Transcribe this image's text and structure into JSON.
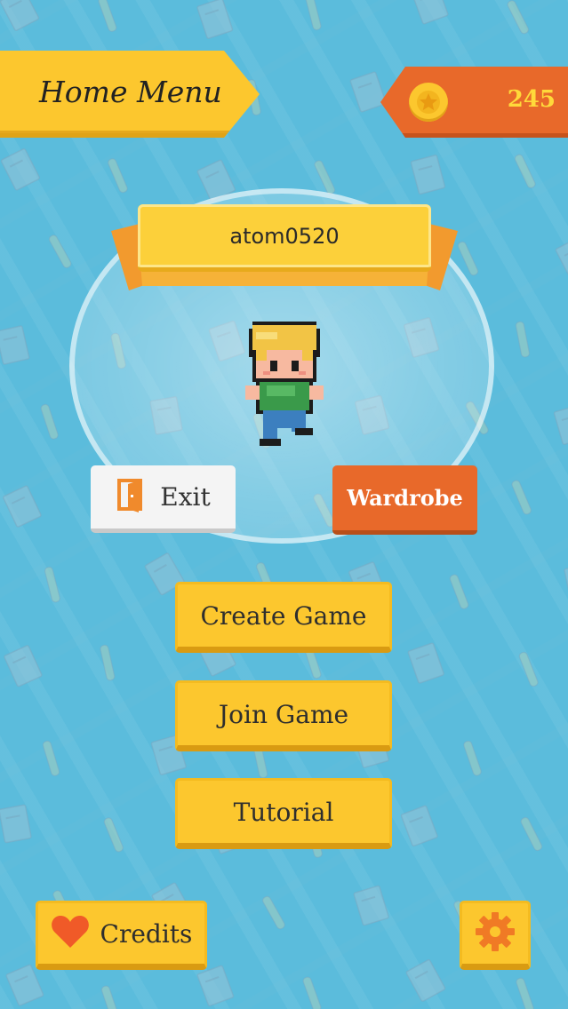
{
  "header": {
    "title": "Home Menu",
    "coins": "245"
  },
  "player": {
    "name": "atom0520"
  },
  "actions": {
    "exit_label": "Exit",
    "wardrobe_label": "Wardrobe"
  },
  "menu": {
    "items": [
      {
        "label": "Create Game"
      },
      {
        "label": "Join Game"
      },
      {
        "label": "Tutorial"
      }
    ]
  },
  "footer": {
    "credits_label": "Credits"
  },
  "icons": {
    "coin": "star-coin-icon",
    "exit": "door-exit-icon",
    "credits": "heart-icon",
    "settings": "gear-icon"
  },
  "colors": {
    "background": "#5bbcdc",
    "primary_yellow": "#fcc72e",
    "accent_orange": "#e8692a",
    "coin_text": "#ffd93a"
  }
}
